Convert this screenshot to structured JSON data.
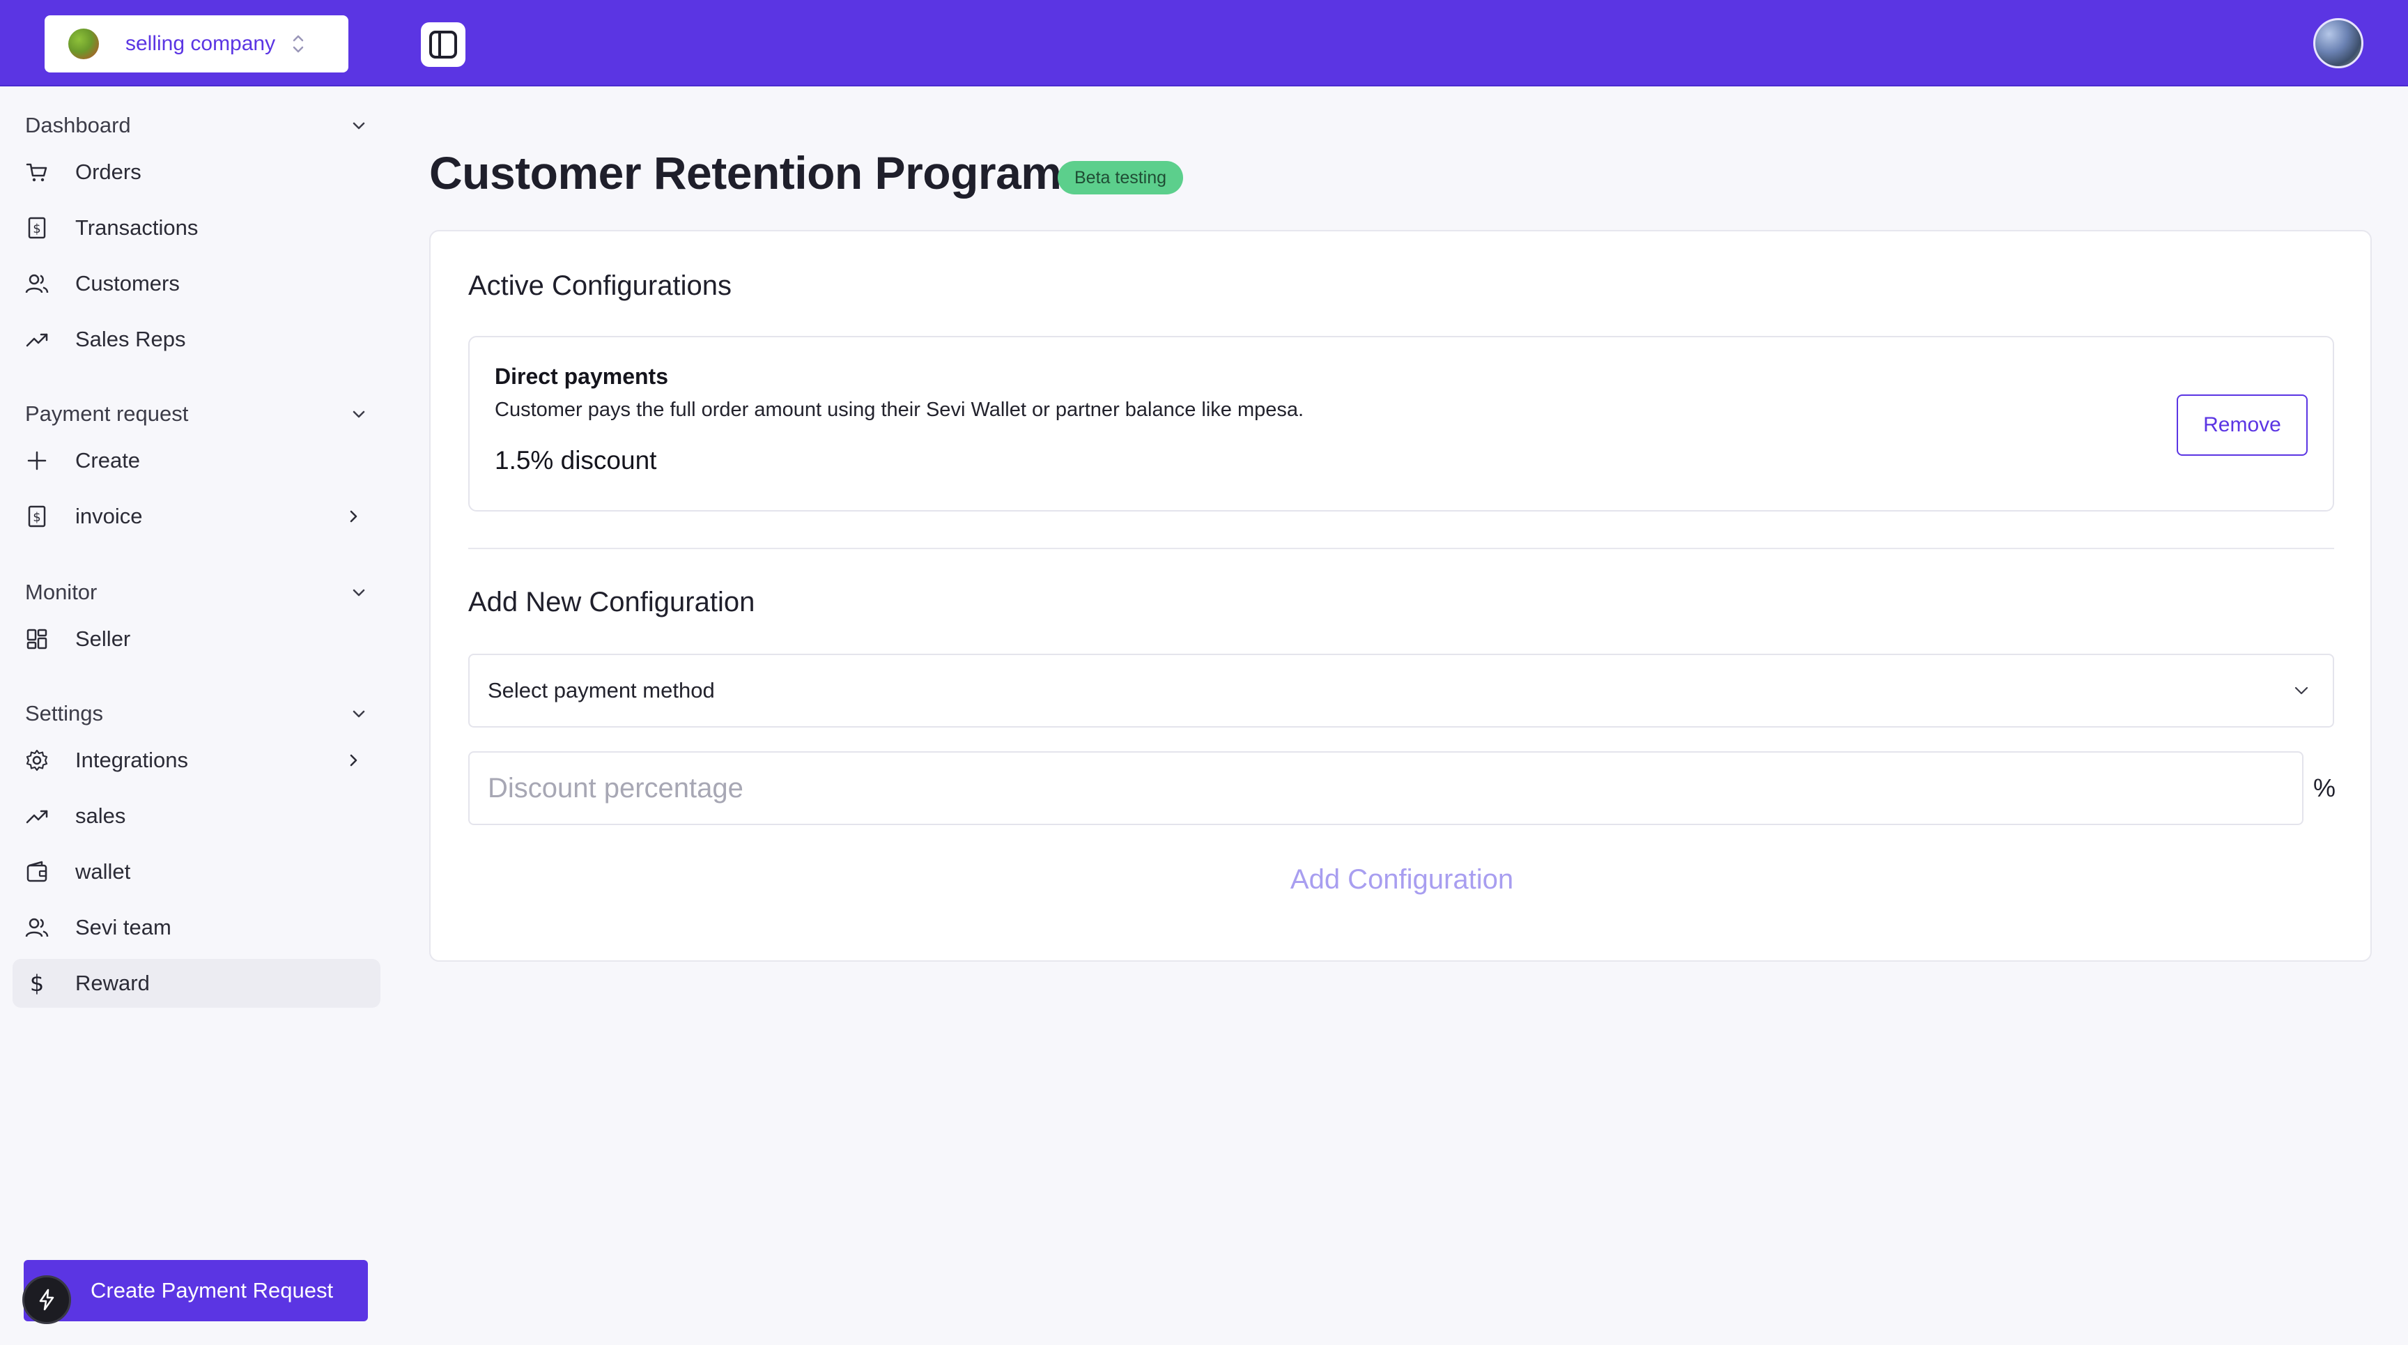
{
  "topbar": {
    "company_name": "selling company",
    "brand_color": "#5b35e3",
    "icons": [
      "company-logo",
      "chevron-updown-icon",
      "panel-toggle-icon",
      "user-avatar"
    ]
  },
  "sidebar": {
    "groups": {
      "dashboard": "Dashboard",
      "payment_request": "Payment request",
      "monitor": "Monitor",
      "settings": "Settings"
    },
    "items": {
      "orders": "Orders",
      "transactions": "Transactions",
      "customers": "Customers",
      "sales_reps": "Sales Reps",
      "create": "Create",
      "invoice": "invoice",
      "seller": "Seller",
      "integrations": "Integrations",
      "sales": "sales",
      "wallet": "wallet",
      "sevi_team": "Sevi team",
      "reward": "Reward"
    },
    "active_item": "Reward",
    "create_button": "Create Payment Request"
  },
  "main": {
    "title": "Customer Retention Program",
    "badge": "Beta testing",
    "active_section_title": "Active Configurations",
    "active_config": {
      "name": "Direct payments",
      "description": "Customer pays the full order amount using their Sevi Wallet or partner balance like mpesa.",
      "discount": "1.5% discount",
      "remove_label": "Remove"
    },
    "add_section_title": "Add New Configuration",
    "payment_method_select": "Select payment method",
    "discount_placeholder": "Discount percentage",
    "percent_symbol": "%",
    "add_button": "Add Configuration"
  }
}
